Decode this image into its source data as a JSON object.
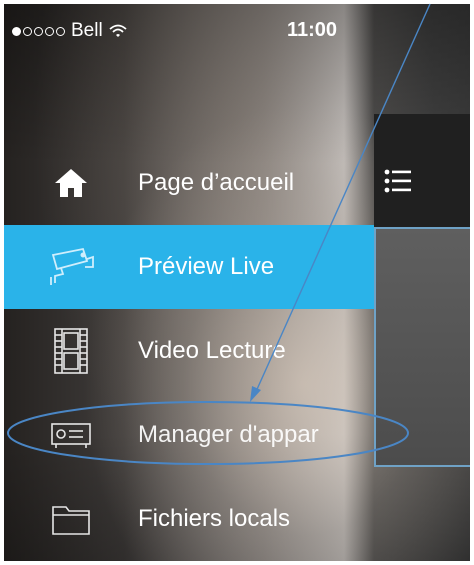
{
  "status_bar": {
    "carrier": "Bell",
    "time": "11:00",
    "signal_dots_filled": 1,
    "signal_dots_total": 5,
    "wifi_icon": "wifi-icon"
  },
  "menu": {
    "items": [
      {
        "label": "Page d’accueil",
        "icon": "home-icon",
        "active": false
      },
      {
        "label": "Préview Live",
        "icon": "camera-icon",
        "active": true
      },
      {
        "label": "Video Lecture",
        "icon": "film-icon",
        "active": false
      },
      {
        "label": "Manager d'appar",
        "icon": "device-manager-icon",
        "active": false
      },
      {
        "label": "Fichiers locals",
        "icon": "folder-icon",
        "active": false
      }
    ]
  },
  "right_panel": {
    "list_icon": "list-menu-icon"
  },
  "colors": {
    "active_item": "#2ab3e9",
    "annotation": "#4a86c5",
    "right_bar": "#202020"
  }
}
